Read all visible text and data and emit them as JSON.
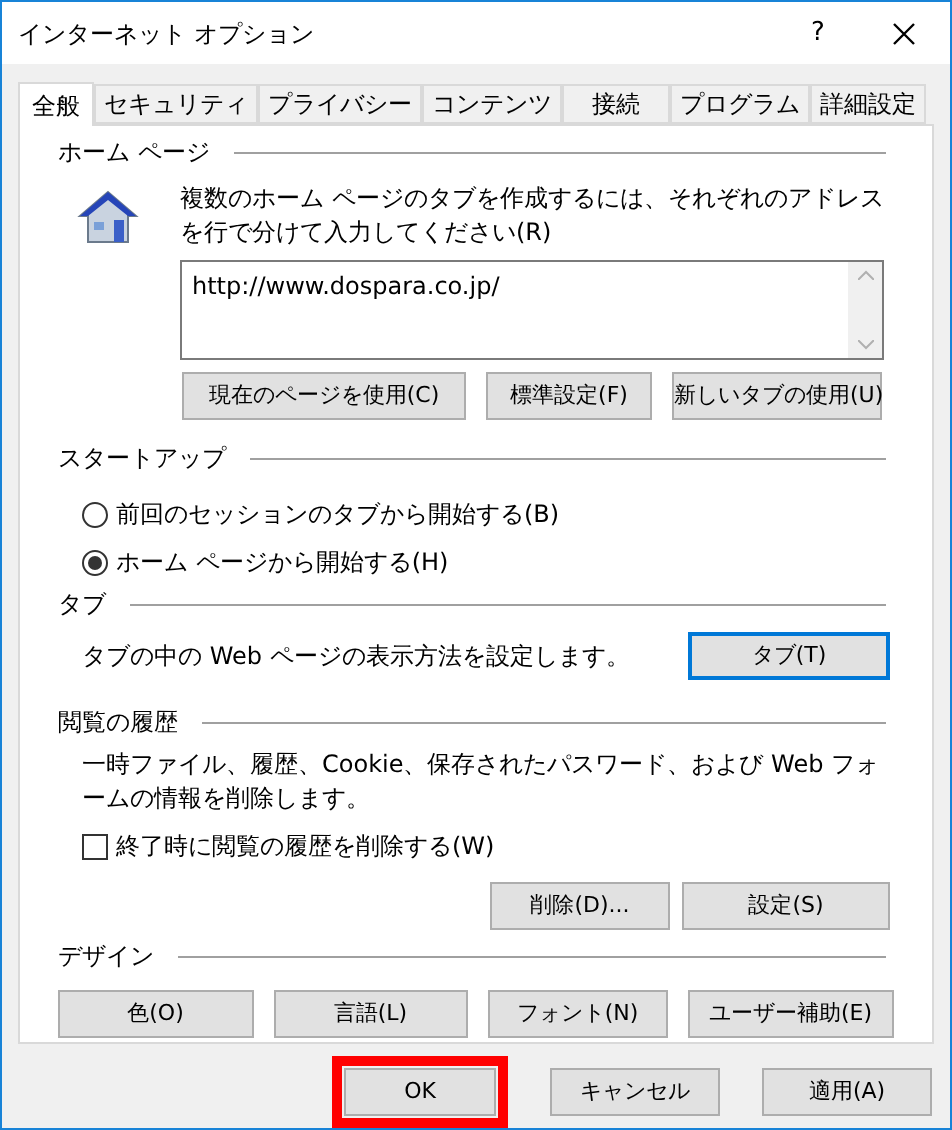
{
  "window": {
    "title": "インターネット オプション",
    "help": "?"
  },
  "tabs": [
    {
      "label": "全般",
      "selected": true
    },
    {
      "label": "セキュリティ",
      "selected": false
    },
    {
      "label": "プライバシー",
      "selected": false
    },
    {
      "label": "コンテンツ",
      "selected": false
    },
    {
      "label": "接続",
      "selected": false
    },
    {
      "label": "プログラム",
      "selected": false
    },
    {
      "label": "詳細設定",
      "selected": false
    }
  ],
  "home_page": {
    "heading": "ホーム ページ",
    "description": "複数のホーム ページのタブを作成するには、それぞれのアドレスを行で分けて入力してください(R)",
    "url": "http://www.dospara.co.jp/",
    "buttons": [
      "現在のページを使用(C)",
      "標準設定(F)",
      "新しいタブの使用(U)"
    ]
  },
  "startup": {
    "heading": "スタートアップ",
    "options": [
      {
        "label": "前回のセッションのタブから開始する(B)",
        "selected": false
      },
      {
        "label": "ホーム ページから開始する(H)",
        "selected": true
      }
    ]
  },
  "tab_settings": {
    "heading": "タブ",
    "description": "タブの中の Web ページの表示方法を設定します。",
    "button": {
      "label": "タブ(T)",
      "focused": true
    }
  },
  "history": {
    "heading": "閲覧の履歴",
    "description": "一時ファイル、履歴、Cookie、保存されたパスワード、および Web フォームの情報を削除します。",
    "checkbox": {
      "label": "終了時に閲覧の履歴を削除する(W)",
      "checked": false
    },
    "buttons": [
      "削除(D)...",
      "設定(S)"
    ]
  },
  "design": {
    "heading": "デザイン",
    "buttons": [
      "色(O)",
      "言語(L)",
      "フォント(N)",
      "ユーザー補助(E)"
    ]
  },
  "footer_buttons": [
    {
      "label": "OK",
      "highlighted": true
    },
    {
      "label": "キャンセル",
      "highlighted": false
    },
    {
      "label": "適用(A)",
      "highlighted": false
    }
  ]
}
